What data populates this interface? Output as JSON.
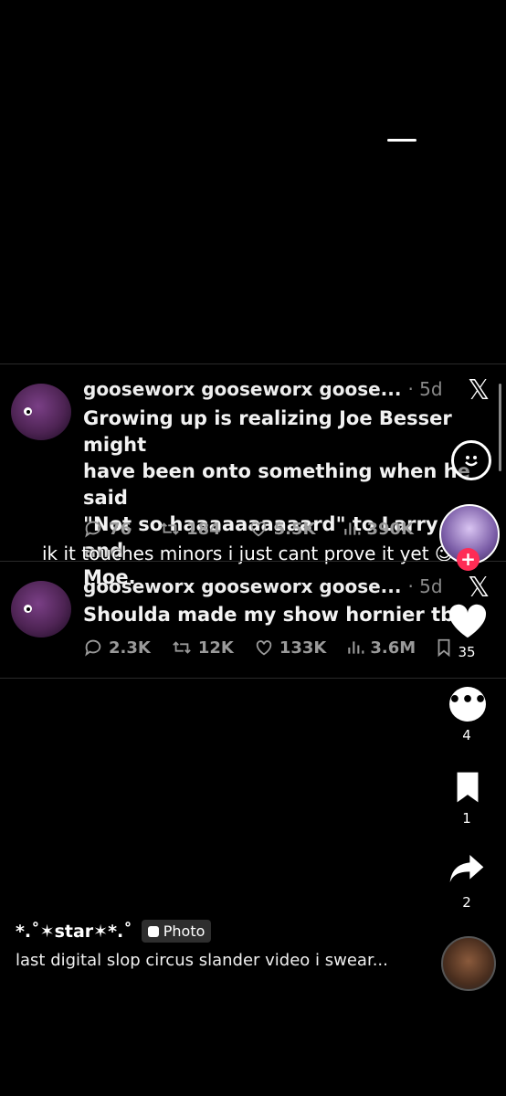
{
  "tweet1": {
    "name": "gooseworx gooseworx goose...",
    "time": "· 5d",
    "line1": "Growing up is realizing Joe Besser might",
    "line2": "have been onto something when he said",
    "line3": "\"Not so haaaaaaaaaard\" to Larry and",
    "line4": "Moe.",
    "replies": "76",
    "retweets": "184",
    "likes": "5.5K",
    "views": "390K"
  },
  "overlay_caption": "ik it touches minors i just cant prove it yet",
  "tweet2": {
    "name": "gooseworx gooseworx goose...",
    "time": "· 5d",
    "text": "Shoulda made my show hornier tbh.",
    "replies": "2.3K",
    "retweets": "12K",
    "likes": "133K",
    "views": "3.6M"
  },
  "sidebar": {
    "likes_count": "35",
    "comments_count": "4",
    "saves_count": "1",
    "shares_count": "2"
  },
  "post": {
    "username": "*.˚✶star✶*.˚",
    "badge": "Photo",
    "description": "last digital slop circus slander video i swear..."
  },
  "colors": {
    "accent_red": "#fe2c55",
    "stat_gray": "#9a9a9a"
  }
}
